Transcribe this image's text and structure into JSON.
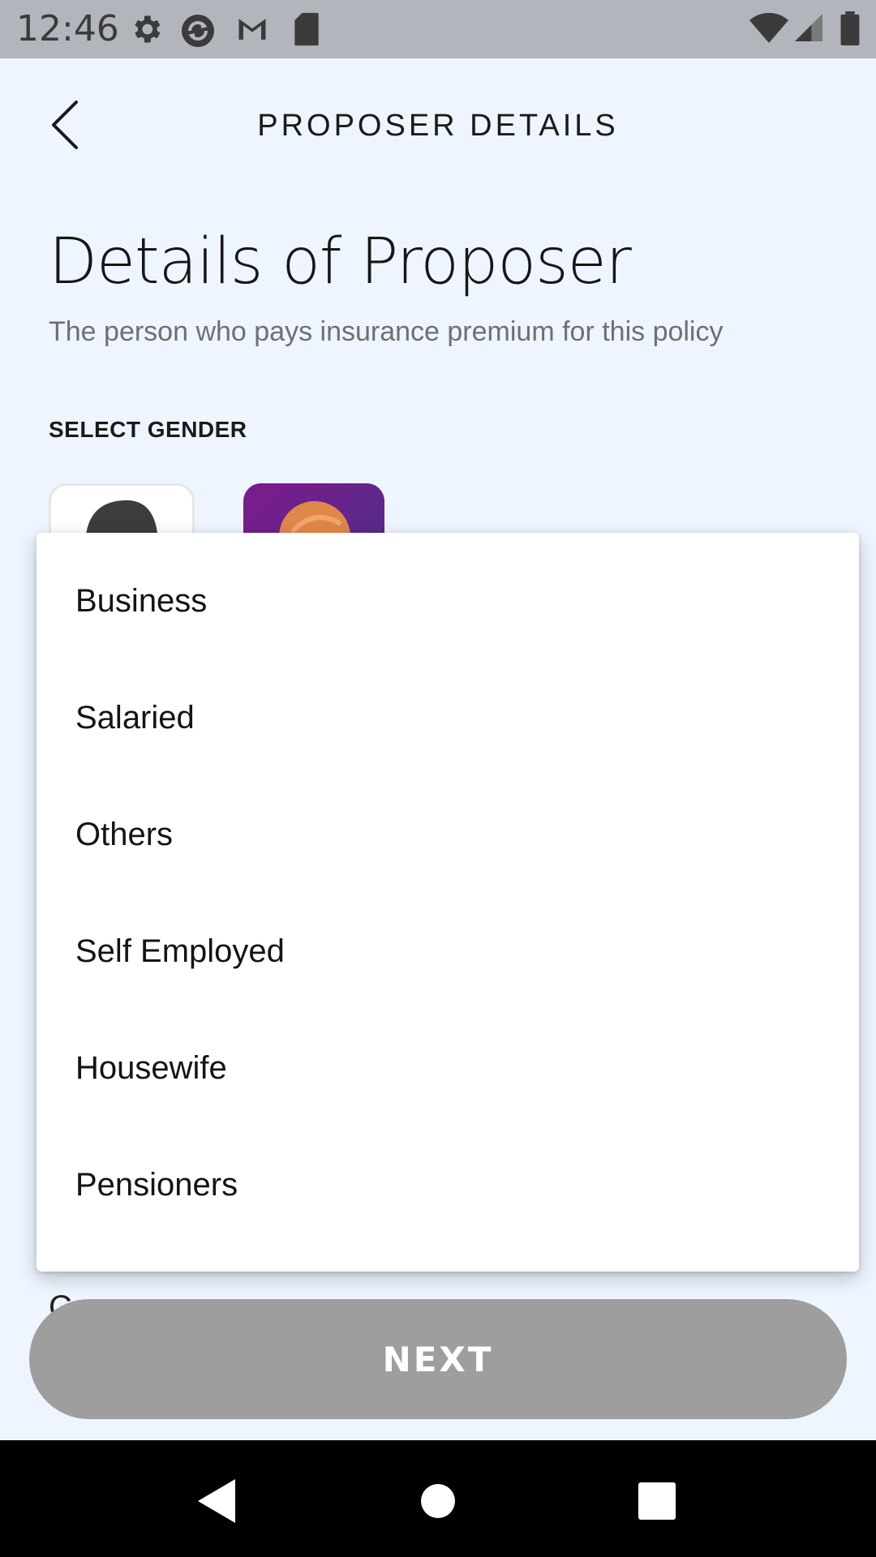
{
  "status_bar": {
    "time": "12:46",
    "left_icons": [
      "gear-icon",
      "sync-icon",
      "gmail-icon",
      "sd-card-icon"
    ],
    "right_icons": [
      "wifi-icon",
      "cell-signal-icon",
      "battery-icon"
    ]
  },
  "header": {
    "title": "PROPOSER DETAILS",
    "back_icon": "chevron-left-icon"
  },
  "page": {
    "title": "Details of Proposer",
    "subtitle": "The person who pays insurance premium for this policy",
    "gender_label": "SELECT GENDER",
    "gender_options": [
      "male-avatar",
      "female-avatar"
    ]
  },
  "dropdown": {
    "options": [
      {
        "label": "Business"
      },
      {
        "label": "Salaried"
      },
      {
        "label": "Others"
      },
      {
        "label": "Self Employed"
      },
      {
        "label": "Housewife"
      },
      {
        "label": "Pensioners"
      }
    ]
  },
  "footer": {
    "next_label": "NEXT",
    "next_color": "#9e9e9e"
  },
  "nav_bar": {
    "icons": [
      "nav-back-icon",
      "nav-home-icon",
      "nav-recents-icon"
    ]
  }
}
